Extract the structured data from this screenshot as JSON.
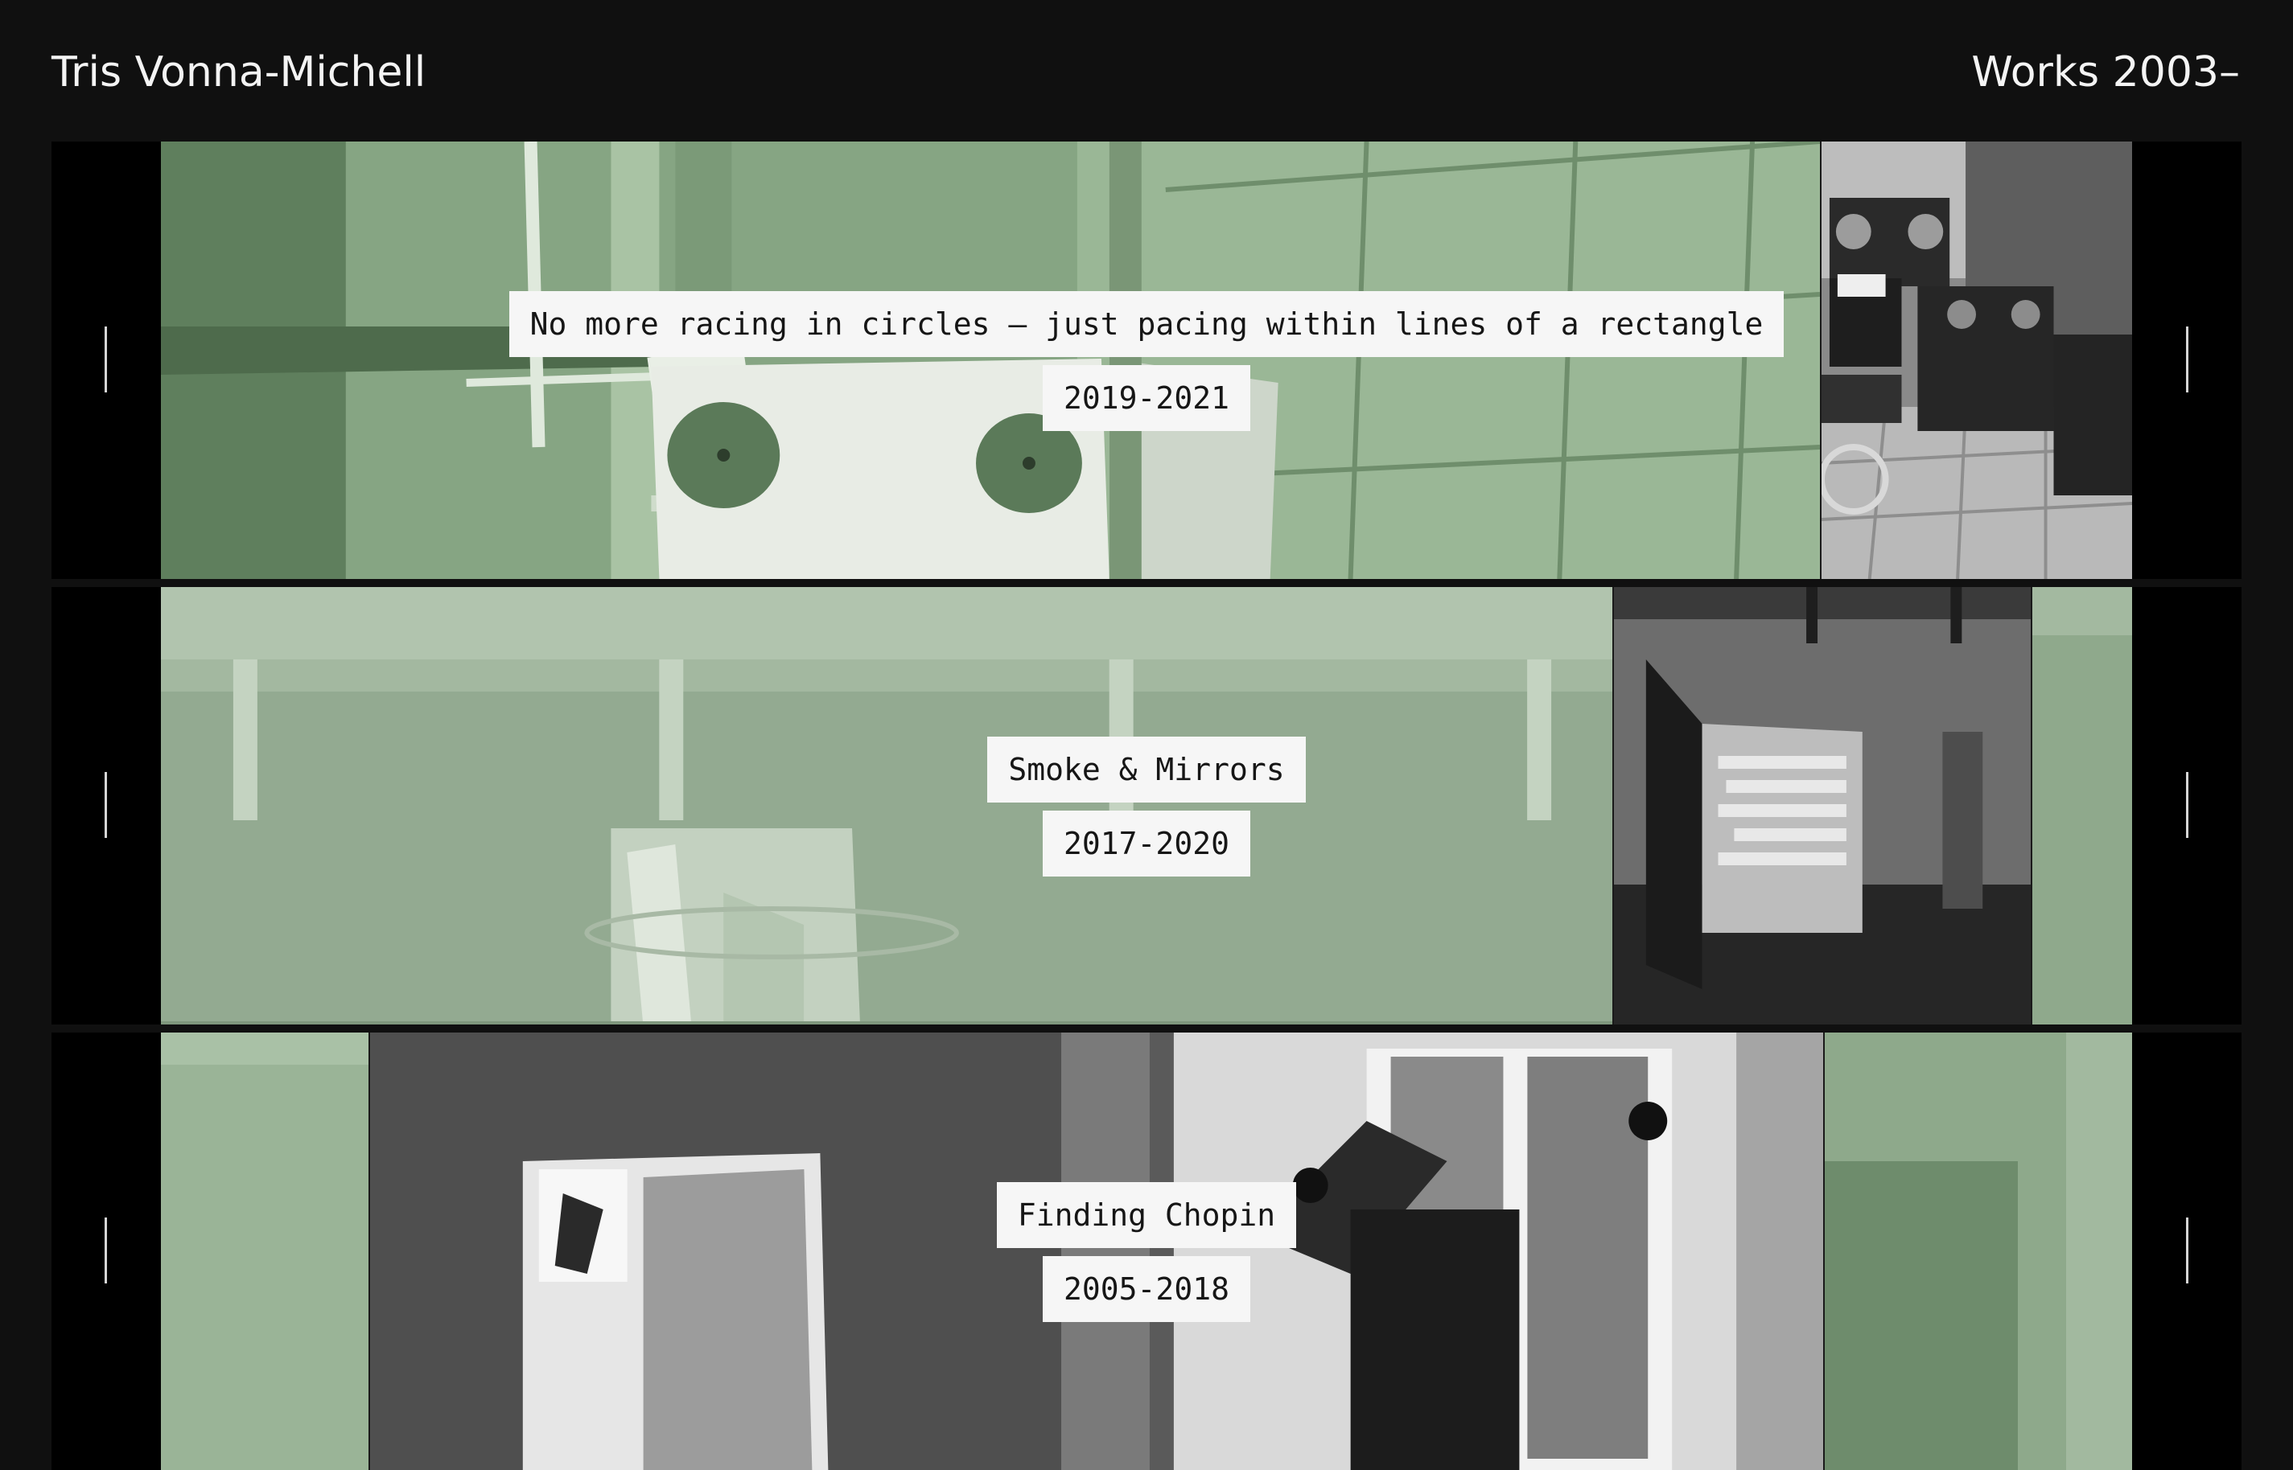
{
  "header": {
    "site_title": "Tris Vonna-Michell",
    "works_link": "Works 2003–"
  },
  "projects": [
    {
      "title": "No more racing in circles – just pacing within lines of a rectangle",
      "years": "2019-2021"
    },
    {
      "title": "Smoke & Mirrors",
      "years": "2017-2020"
    },
    {
      "title": "Finding Chopin",
      "years": "2005-2018"
    }
  ],
  "colors": {
    "page_background": "#101010",
    "green_tint": "#8faa8c",
    "label_background": "#f6f6f6",
    "label_text": "#161616"
  }
}
